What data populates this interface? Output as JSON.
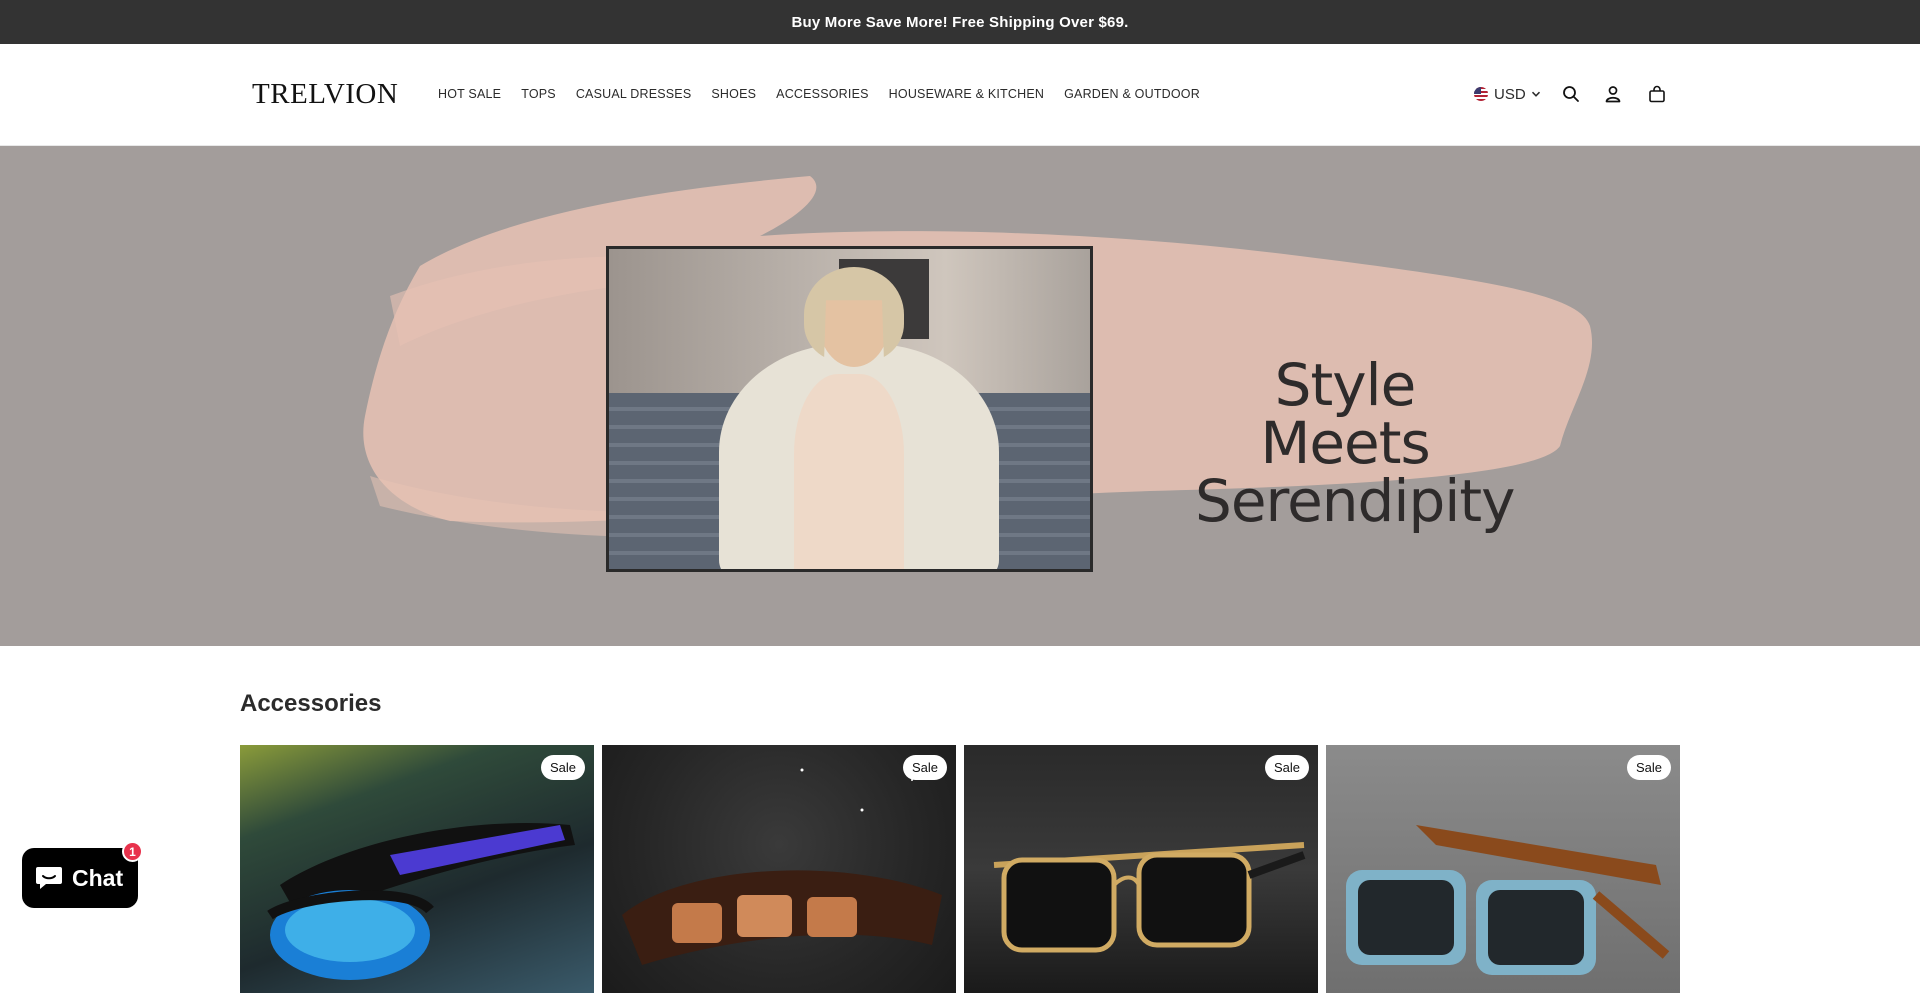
{
  "announcement": {
    "text": "Buy More Save More! Free Shipping Over $69."
  },
  "header": {
    "logo": "TRELVION",
    "nav": [
      {
        "label": "HOT SALE"
      },
      {
        "label": "TOPS"
      },
      {
        "label": "CASUAL DRESSES"
      },
      {
        "label": "SHOES"
      },
      {
        "label": "ACCESSORIES"
      },
      {
        "label": "HOUSEWARE & KITCHEN"
      },
      {
        "label": "GARDEN & OUTDOOR"
      }
    ],
    "currency": "USD",
    "icons": [
      "us-flag-icon",
      "chevron-down-icon",
      "search-icon",
      "account-icon",
      "cart-icon"
    ]
  },
  "hero": {
    "title_line1": "Style Meets",
    "title_line2": "Serendipity",
    "background_color": "#a39d9b",
    "brush_color": "#e8c2b4"
  },
  "section": {
    "title": "Accessories",
    "products": [
      {
        "badge": "Sale"
      },
      {
        "badge": "Sale"
      },
      {
        "badge": "Sale"
      },
      {
        "badge": "Sale"
      }
    ]
  },
  "chat": {
    "label": "Chat",
    "badge_count": "1"
  }
}
